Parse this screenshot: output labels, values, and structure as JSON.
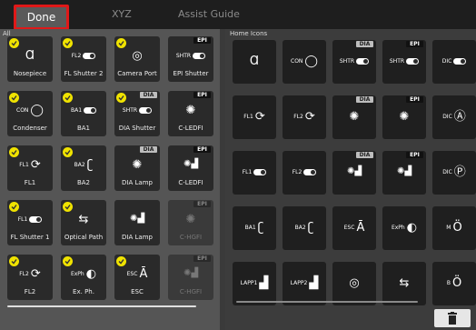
{
  "topbar": {
    "done_label": "Done",
    "tab_xyz": "XYZ",
    "tab_assist": "Assist Guide"
  },
  "left_panel": {
    "label": "All",
    "tiles": [
      {
        "caption": "Nosepiece",
        "glyph": "Ɑ",
        "prefix": "",
        "tag": "",
        "checked": true,
        "dim": false,
        "icon": "nosepiece-icon"
      },
      {
        "caption": "FL Shutter 2",
        "glyph": "",
        "prefix": "FL2",
        "tag": "",
        "checked": true,
        "dim": false,
        "icon": "shutter-toggle-icon"
      },
      {
        "caption": "Camera Port",
        "glyph": "◎",
        "prefix": "",
        "tag": "",
        "checked": true,
        "dim": false,
        "icon": "camera-port-icon"
      },
      {
        "caption": "EPI Shutter",
        "glyph": "",
        "prefix": "SHTR",
        "tag": "EPI",
        "checked": false,
        "dim": false,
        "icon": "shutter-toggle-icon"
      },
      {
        "caption": "Condenser",
        "glyph": "◯",
        "prefix": "CON",
        "tag": "",
        "checked": true,
        "dim": false,
        "icon": "condenser-icon"
      },
      {
        "caption": "BA1",
        "glyph": "",
        "prefix": "BA1",
        "tag": "",
        "checked": true,
        "dim": false,
        "icon": "toggle-icon"
      },
      {
        "caption": "DIA Shutter",
        "glyph": "",
        "prefix": "SHTR",
        "tag": "DIA",
        "checked": true,
        "dim": false,
        "icon": "shutter-toggle-icon"
      },
      {
        "caption": "C-LEDFI",
        "glyph": "✺",
        "prefix": "",
        "tag": "EPI",
        "checked": false,
        "dim": false,
        "icon": "led-icon"
      },
      {
        "caption": "FL1",
        "glyph": "⟳",
        "prefix": "FL1",
        "tag": "",
        "checked": true,
        "dim": false,
        "icon": "filter-turret-icon"
      },
      {
        "caption": "BA2",
        "glyph": "ʗ",
        "prefix": "BA2",
        "tag": "",
        "checked": true,
        "dim": false,
        "icon": "barrier-filter-icon"
      },
      {
        "caption": "DIA Lamp",
        "glyph": "✺",
        "prefix": "",
        "tag": "DIA",
        "checked": false,
        "dim": false,
        "icon": "lamp-icon"
      },
      {
        "caption": "C-LEDFI",
        "glyph": "✺▟",
        "prefix": "",
        "tag": "EPI",
        "checked": false,
        "dim": false,
        "icon": "led-intensity-icon"
      },
      {
        "caption": "FL Shutter 1",
        "glyph": "",
        "prefix": "FL1",
        "tag": "",
        "checked": true,
        "dim": false,
        "icon": "shutter-toggle-icon"
      },
      {
        "caption": "Optical Path",
        "glyph": "⇆",
        "prefix": "",
        "tag": "",
        "checked": true,
        "dim": false,
        "icon": "optical-path-icon"
      },
      {
        "caption": "DIA Lamp",
        "glyph": "✺▟",
        "prefix": "",
        "tag": "",
        "checked": false,
        "dim": false,
        "icon": "lamp-intensity-icon"
      },
      {
        "caption": "C-HGFI",
        "glyph": "✺",
        "prefix": "",
        "tag": "EPI",
        "checked": false,
        "dim": true,
        "icon": "hg-lamp-icon"
      },
      {
        "caption": "FL2",
        "glyph": "⟳",
        "prefix": "FL2",
        "tag": "",
        "checked": true,
        "dim": false,
        "icon": "filter-turret-icon"
      },
      {
        "caption": "Ex. Ph.",
        "glyph": "◐",
        "prefix": "ExPh",
        "tag": "",
        "checked": true,
        "dim": false,
        "icon": "ex-phase-icon"
      },
      {
        "caption": "ESC",
        "glyph": "Ā",
        "prefix": "ESC",
        "tag": "",
        "checked": true,
        "dim": false,
        "icon": "esc-icon"
      },
      {
        "caption": "C-HGFI",
        "glyph": "✺▟",
        "prefix": "",
        "tag": "EPI",
        "checked": false,
        "dim": true,
        "icon": "hg-lamp-intensity-icon"
      }
    ]
  },
  "right_panel": {
    "label": "Home Icons",
    "tiles": [
      {
        "glyph": "Ɑ",
        "prefix": "",
        "tag": "",
        "icon": "nosepiece-icon"
      },
      {
        "glyph": "◯",
        "prefix": "CON",
        "tag": "",
        "icon": "condenser-icon"
      },
      {
        "glyph": "",
        "prefix": "SHTR",
        "tag": "DIA",
        "icon": "shutter-toggle-icon"
      },
      {
        "glyph": "",
        "prefix": "SHTR",
        "tag": "EPI",
        "icon": "shutter-toggle-icon"
      },
      {
        "glyph": "",
        "prefix": "DIC",
        "tag": "",
        "icon": "dic-toggle-icon"
      },
      {
        "glyph": "⟳",
        "prefix": "FL1",
        "tag": "",
        "icon": "filter-turret-icon"
      },
      {
        "glyph": "⟳",
        "prefix": "FL2",
        "tag": "",
        "icon": "filter-turret-icon"
      },
      {
        "glyph": "✺",
        "prefix": "",
        "tag": "DIA",
        "icon": "lamp-icon"
      },
      {
        "glyph": "✺",
        "prefix": "",
        "tag": "EPI",
        "icon": "led-icon"
      },
      {
        "glyph": "Ⓐ",
        "prefix": "DIC",
        "tag": "",
        "icon": "dic-a-icon"
      },
      {
        "glyph": "",
        "prefix": "FL1",
        "tag": "",
        "icon": "shutter-toggle-icon"
      },
      {
        "glyph": "",
        "prefix": "FL2",
        "tag": "",
        "icon": "shutter-toggle-icon"
      },
      {
        "glyph": "✺▟",
        "prefix": "",
        "tag": "DIA",
        "icon": "lamp-intensity-icon"
      },
      {
        "glyph": "✺▟",
        "prefix": "",
        "tag": "EPI",
        "icon": "led-intensity-icon"
      },
      {
        "glyph": "Ⓟ",
        "prefix": "DIC",
        "tag": "",
        "icon": "dic-p-icon"
      },
      {
        "glyph": "ʗ",
        "prefix": "BA1",
        "tag": "",
        "icon": "barrier-filter-icon"
      },
      {
        "glyph": "ʗ",
        "prefix": "BA2",
        "tag": "",
        "icon": "barrier-filter-icon"
      },
      {
        "glyph": "Ā",
        "prefix": "ESC",
        "tag": "",
        "icon": "esc-icon"
      },
      {
        "glyph": "◐",
        "prefix": "ExPh",
        "tag": "",
        "icon": "ex-phase-icon"
      },
      {
        "glyph": "Ö",
        "prefix": "M",
        "tag": "",
        "icon": "magnification-m-icon"
      },
      {
        "glyph": "▟",
        "prefix": "LAPP1",
        "tag": "",
        "icon": "lapp-icon"
      },
      {
        "glyph": "▟",
        "prefix": "LAPP2",
        "tag": "",
        "icon": "lapp-icon"
      },
      {
        "glyph": "◎",
        "prefix": "",
        "tag": "",
        "icon": "camera-port-icon"
      },
      {
        "glyph": "⇆",
        "prefix": "",
        "tag": "",
        "icon": "optical-path-icon"
      },
      {
        "glyph": "Ö",
        "prefix": "B",
        "tag": "",
        "icon": "magnification-b-icon"
      }
    ]
  },
  "trash": {
    "icon": "trash-icon"
  }
}
